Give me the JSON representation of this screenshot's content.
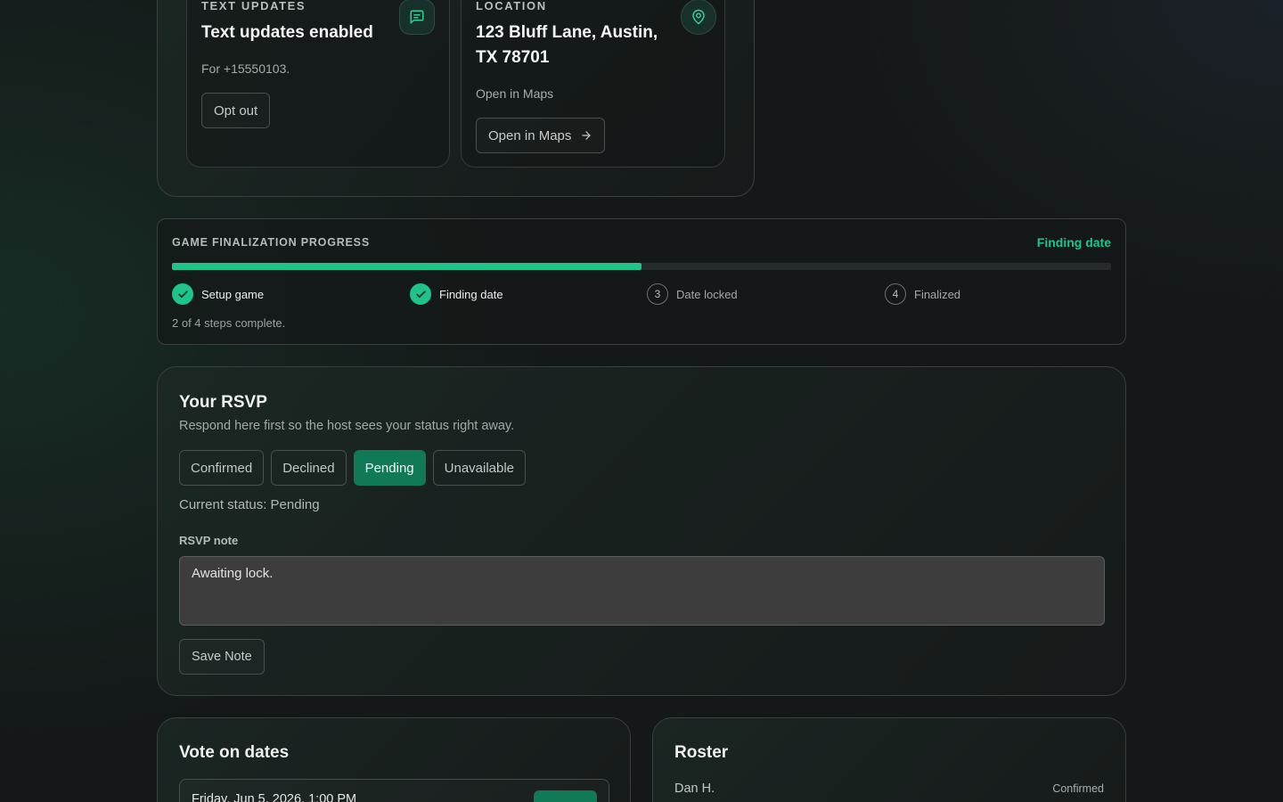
{
  "text_updates": {
    "kicker": "TEXT UPDATES",
    "title": "Text updates enabled",
    "subtitle": "For +15550103.",
    "button": "Opt out",
    "icon": "message-icon"
  },
  "location": {
    "kicker": "LOCATION",
    "title": "123 Bluff Lane, Austin, TX 78701",
    "subtitle": "Open in Maps",
    "button": "Open in Maps",
    "icon": "map-pin-icon"
  },
  "progress": {
    "label": "GAME FINALIZATION PROGRESS",
    "status": "Finding date",
    "fraction": 0.5,
    "steps": [
      {
        "label": "Setup game",
        "done": true,
        "num": "1"
      },
      {
        "label": "Finding date",
        "done": true,
        "num": "2"
      },
      {
        "label": "Date locked",
        "done": false,
        "num": "3"
      },
      {
        "label": "Finalized",
        "done": false,
        "num": "4"
      }
    ],
    "footer": "2 of 4 steps complete."
  },
  "rsvp": {
    "title": "Your RSVP",
    "description": "Respond here first so the host sees your status right away.",
    "options": [
      "Confirmed",
      "Declined",
      "Pending",
      "Unavailable"
    ],
    "selected": "Pending",
    "current_status": "Current status: Pending",
    "note_label": "RSVP note",
    "note_value": "Awaiting lock.",
    "save_button": "Save Note"
  },
  "vote": {
    "title": "Vote on dates",
    "first_date": "Friday, Jun 5, 2026, 1:00 PM"
  },
  "roster": {
    "title": "Roster",
    "first_name": "Dan H.",
    "first_status": "Confirmed"
  },
  "colors": {
    "accent": "#1ec48a",
    "accent_dark": "#0f7a55"
  }
}
